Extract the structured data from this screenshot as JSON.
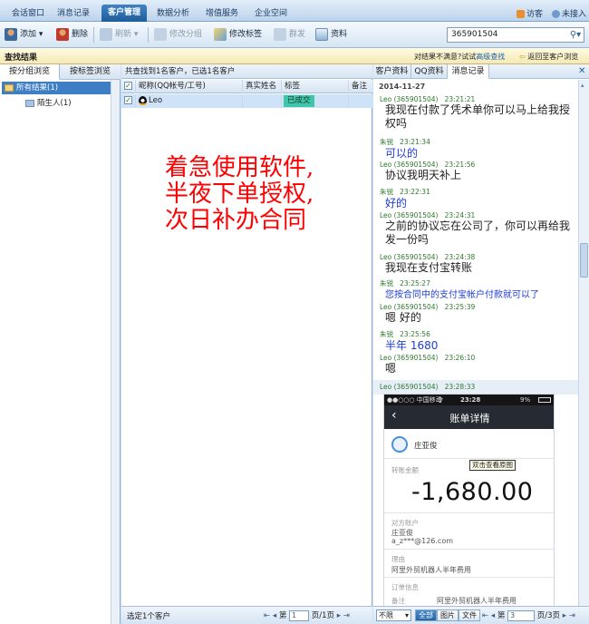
{
  "topnav": {
    "tabs": [
      "会话窗口",
      "消息记录",
      "客户管理",
      "数据分析",
      "增值服务",
      "企业空间"
    ],
    "active_tab": "客户管理",
    "visitor_label": "访客",
    "status_label": "未接入"
  },
  "toolbar": {
    "add_label": "添加",
    "delete_label": "删除",
    "refresh_label": "刷新",
    "edit_group_label": "修改分组",
    "edit_tag_label": "修改标签",
    "mass_send_label": "群发",
    "profile_label": "资料",
    "search_value": "365901504"
  },
  "results_bar": {
    "title": "查找结果",
    "hint_prefix": "对结果不满意?试试",
    "hint_link": "高级查找",
    "back_label": "返回至客户浏览"
  },
  "left_panel": {
    "tabs": [
      "按分组浏览",
      "按标签浏览"
    ],
    "tree": [
      {
        "label": "所有结果(1)",
        "selected": true
      },
      {
        "label": "陌生人(1)",
        "selected": false
      }
    ]
  },
  "middle_panel": {
    "summary": "共查找到1名客户，已选1名客户",
    "columns": [
      "昵称(QQ帐号/工号)",
      "真实姓名",
      "标签",
      "备注"
    ],
    "rows": [
      {
        "nickname": "Leo",
        "real_name": "",
        "tag": "已成交",
        "note": ""
      }
    ],
    "overlay_lines": [
      "着急使用软件,",
      "半夜下单授权,",
      "次日补办合同"
    ],
    "footer_selected": "选定1个客户",
    "footer_page_label": "第",
    "footer_page_value": "1",
    "footer_page_total": "页/1页"
  },
  "right_panel": {
    "tabs": [
      "客户资料",
      "QQ资料",
      "消息记录"
    ],
    "active_tab": "消息记录",
    "date": "2014-11-27",
    "messages": [
      {
        "sender": "Leo (365901504)",
        "time": "23:21:21",
        "text": "我现在付款了凭术单你可以马上给我授权吗",
        "self": false
      },
      {
        "sender": "朱锐",
        "time": "23:21:34",
        "text": "可以的",
        "self": true
      },
      {
        "sender": "Leo (365901504)",
        "time": "23:21:56",
        "text": "协议我明天补上",
        "self": false
      },
      {
        "sender": "朱锐",
        "time": "23:22:31",
        "text": "好的",
        "self": true
      },
      {
        "sender": "Leo (365901504)",
        "time": "23:24:31",
        "text": "之前的协议忘在公司了，你可以再给我发一份吗",
        "self": false
      },
      {
        "sender": "Leo (365901504)",
        "time": "23:24:38",
        "text": "我现在支付宝转账",
        "self": false
      },
      {
        "sender": "朱锐",
        "time": "23:25:27",
        "text": "您按合同中的支付宝帐户付款就可以了",
        "self": true
      },
      {
        "sender": "Leo (365901504)",
        "time": "23:25:39",
        "text": "嗯 好的",
        "self": false
      },
      {
        "sender": "朱锐",
        "time": "23:25:56",
        "text": "半年 1680",
        "self": true
      },
      {
        "sender": "Leo (365901504)",
        "time": "23:26:10",
        "text": "嗯",
        "self": false
      },
      {
        "sender": "Leo (365901504)",
        "time": "23:28:33",
        "text": "",
        "self": false
      }
    ],
    "phone": {
      "carrier": "●●○○○ 中国移动",
      "wifi": "令",
      "clock": "23:28",
      "battery": "9%",
      "title": "账单详情",
      "payee": "庄亚俊",
      "view_original": "双击查看原图",
      "amount_label": "转账金额",
      "amount": "-1,680.00",
      "account_label": "对方账户",
      "account_name": "庄亚俊",
      "account_email": "a_z***@126.com",
      "reason_label": "理由",
      "reason": "阿里外贸机器人半年费用",
      "order_label": "订单信息",
      "remark_label": "备注",
      "remark": "阿里外贸机器人半年费用"
    },
    "footer": {
      "filter": "不限",
      "btn_all": "全部",
      "btn_image": "图片",
      "btn_file": "文件",
      "page_label": "第",
      "page_value": "3",
      "page_total": "页/3页"
    }
  },
  "colors": {
    "accent": "#2a6db0",
    "tag_bg": "#3fc6a8",
    "overlay_red": "#ff0000",
    "self_blue": "#1f3cd6",
    "peer_green": "#2d7a2d"
  }
}
